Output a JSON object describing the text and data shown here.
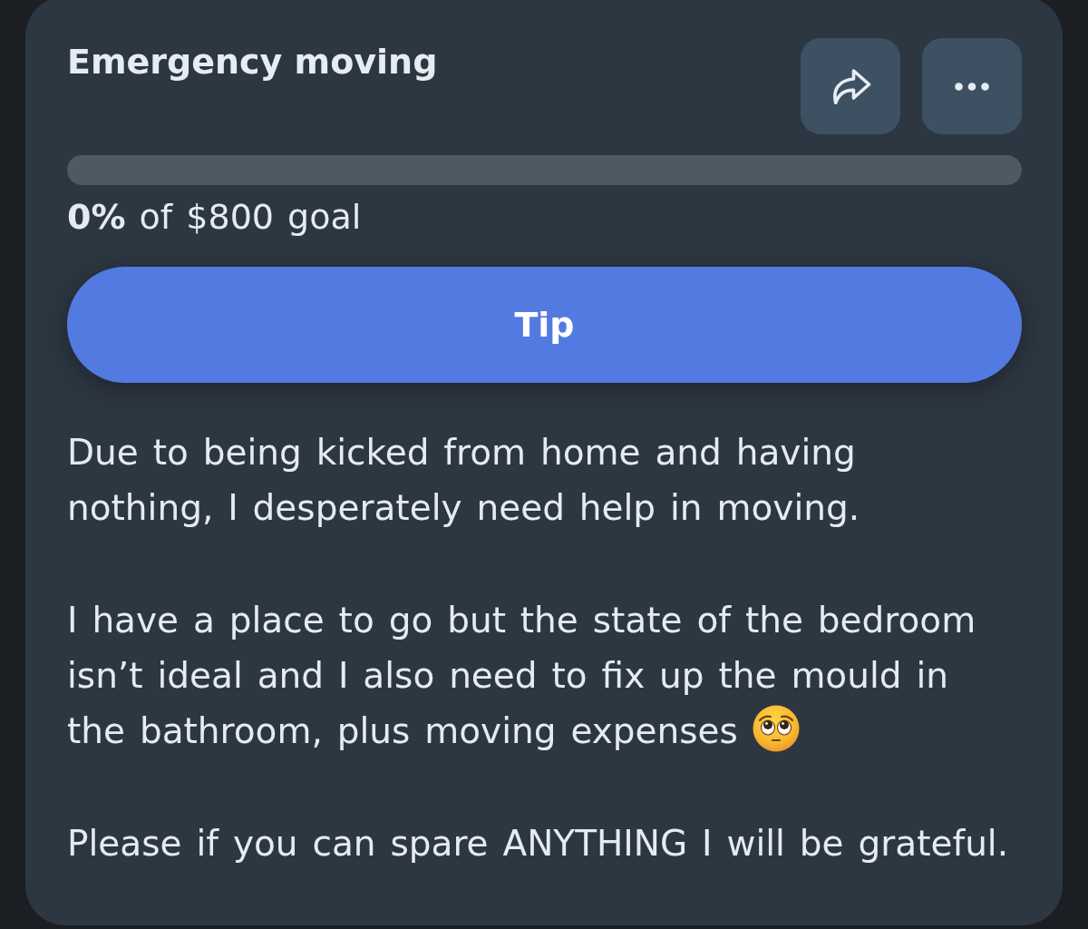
{
  "campaign": {
    "title": "Emergency moving",
    "actions": [
      {
        "kind": "share"
      },
      {
        "kind": "more"
      }
    ],
    "progress": {
      "level": 0,
      "caption": "**0%** of $800 goal"
    },
    "tip_button": {
      "label": "Tip"
    },
    "description": [
      {
        "text": "Due to being kicked from home and having nothing, I desperately need help in moving.",
        "emoji": false
      },
      {
        "text": "I have a place to go but the state of the bedroom isn’t ideal and I also need to fix up the mould in the bathroom, plus moving expenses",
        "emoji": true
      },
      {
        "text": "Please if you can spare ANYTHING I will be grateful.",
        "emoji": false
      }
    ]
  }
}
